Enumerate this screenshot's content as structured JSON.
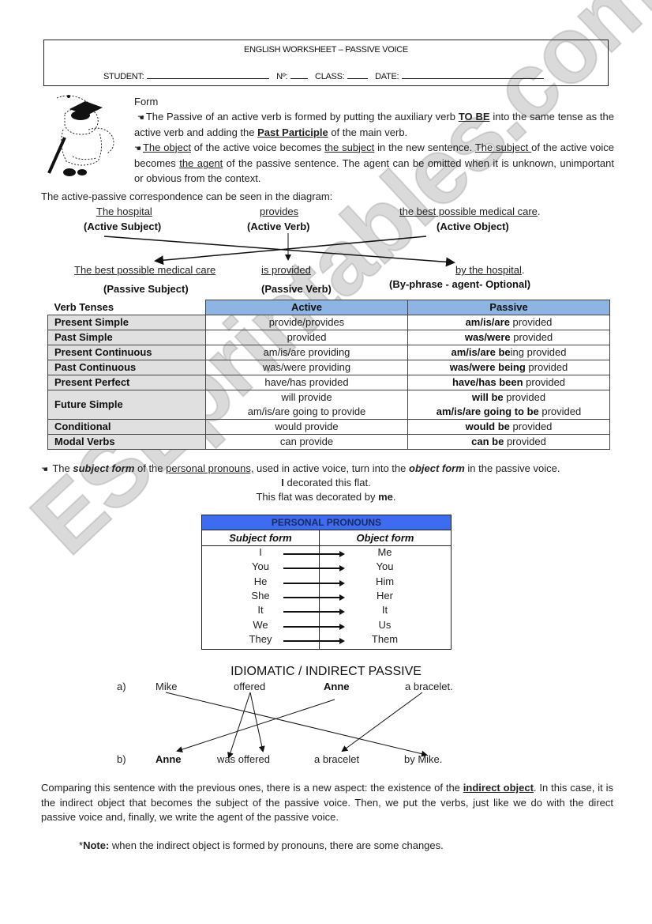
{
  "header": {
    "title": "ENGLISH WORKSHEET – PASSIVE VOICE",
    "student_label": "STUDENT:",
    "number_label": "Nº:",
    "class_label": "CLASS:",
    "date_label": "DATE:"
  },
  "form": {
    "heading": "Form",
    "bullet_icon": "pointing-hand-icon",
    "p1": {
      "t1": "The Passive of an active verb is formed by putting the auxiliary verb ",
      "b1": "TO BE",
      "t2": " into the same tense as the active verb and adding the ",
      "b2": "Past Participle",
      "t3": " of the main verb."
    },
    "p2": {
      "u1": "The object",
      "t1": " of the active voice becomes ",
      "u2": "the subject",
      "t2": " in the new sentence. ",
      "u3": "The subject ",
      "t3": "of the active voice becomes ",
      "u4": "the agent",
      "t4": " of the passive sentence. The agent can be omitted when it is unknown, unimportant or obvious from the context."
    }
  },
  "diagram": {
    "intro": "The active-passive correspondence can be seen in the diagram:",
    "active_subject": "The hospital",
    "active_subject_label": "(Active Subject)",
    "active_verb": "provides",
    "active_verb_label": "(Active Verb)",
    "active_object": "the best possible medical care",
    "active_object_label": "(Active Object)",
    "passive_subject": "The best possible medical care",
    "passive_subject_label": "(Passive Subject)",
    "passive_verb": "is provided",
    "passive_verb_label": "(Passive Verb)",
    "by_phrase": "by the hospital",
    "by_phrase_label": "(By-phrase - agent- Optional)",
    "period": "."
  },
  "tense_table": {
    "headers": [
      "Verb Tenses",
      "Active",
      "Passive"
    ],
    "header_color": "#8eb4e3",
    "rows": [
      {
        "tense": "Present Simple",
        "active": "provide/provides",
        "passive_bold": "am/is/are",
        "passive_rest": " provided"
      },
      {
        "tense": "Past Simple",
        "active": "provided",
        "passive_bold": "was/were",
        "passive_rest": " provided"
      },
      {
        "tense": "Present Continuous",
        "active": "am/is/are providing",
        "passive_bold": "am/is/are be",
        "passive_rest": "ing provided"
      },
      {
        "tense": "Past Continuous",
        "active": "was/were providing",
        "passive_bold": "was/were being",
        "passive_rest": " provided"
      },
      {
        "tense": "Present Perfect",
        "active": "have/has provided",
        "passive_bold": "have/has been",
        "passive_rest": " provided"
      },
      {
        "tense": "Future Simple",
        "active": "will provide",
        "active2": "am/is/are going to provide",
        "passive_bold": "will be",
        "passive_rest": " provided",
        "passive_bold2": "am/is/are going to be",
        "passive_rest2": " provided"
      },
      {
        "tense": "Conditional",
        "active": "would provide",
        "passive_bold": "would be",
        "passive_rest": " provided"
      },
      {
        "tense": "Modal Verbs",
        "active": "can provide",
        "passive_bold": "can be",
        "passive_rest": " provided"
      }
    ]
  },
  "pronoun_note": {
    "t1": " The ",
    "b1": "subject form",
    "t2": " of the ",
    "u1": "personal pronouns,",
    "t3": " used in active voice, turn into the ",
    "b2": "object form",
    "t4": " in the passive voice.",
    "ex1_bold": "I",
    "ex1_rest": " decorated this flat.",
    "ex2_rest": "This flat was decorated by ",
    "ex2_bold": "me",
    "ex2_end": "."
  },
  "pronoun_table": {
    "title": "PERSONAL PRONOUNS",
    "title_color": "#3d6cf0",
    "subject_head": "Subject form",
    "object_head": "Object form",
    "rows": [
      {
        "subject": "I",
        "object": "Me"
      },
      {
        "subject": "You",
        "object": "You"
      },
      {
        "subject": "He",
        "object": "Him"
      },
      {
        "subject": "She",
        "object": "Her"
      },
      {
        "subject": "It",
        "object": "It"
      },
      {
        "subject": "We",
        "object": "Us"
      },
      {
        "subject": "They",
        "object": "Them"
      }
    ]
  },
  "idiomatic": {
    "title": "IDIOMATIC / INDIRECT PASSIVE",
    "a_label": "a)",
    "a_words": [
      "Mike",
      "offered",
      "Anne",
      "a bracelet."
    ],
    "b_label": "b)",
    "b_words": [
      "Anne",
      "was offered",
      "a bracelet",
      "by Mike."
    ]
  },
  "closing": {
    "t1": "Comparing this sentence with the previous ones, there is a new aspect: the existence of the ",
    "b1": "indirect object",
    "t2": ". In this case, it is the indirect object that becomes the subject of the passive voice. Then, we put the verbs, just like we do with the direct passive voice and, finally, we write the agent of the passive voice.",
    "note_star": "*",
    "note_bold": "Note:",
    "note_rest": " when the indirect object is formed by pronouns, there are some changes."
  },
  "watermark": "ESLprintables.com"
}
